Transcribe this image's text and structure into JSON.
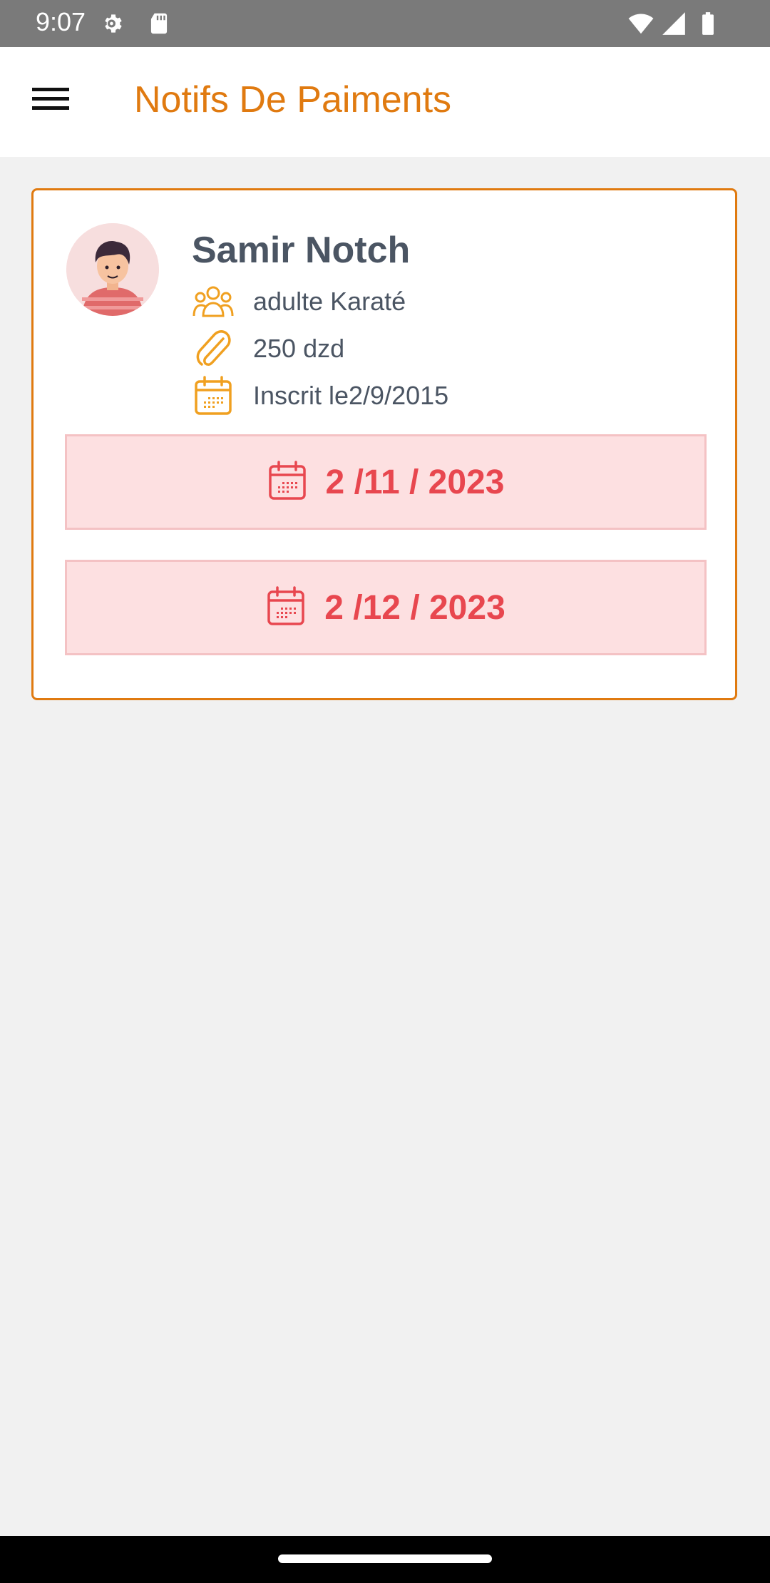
{
  "status_bar": {
    "time": "9:07",
    "icons": [
      "settings-gear-icon",
      "sd-card-icon",
      "wifi-icon",
      "cell-signal-icon",
      "battery-icon"
    ]
  },
  "app_bar": {
    "menu_icon": "hamburger-menu-icon",
    "title": "Notifs De Paiments"
  },
  "student": {
    "avatar_icon": "user-avatar-icon",
    "name": "Samir Notch",
    "details": [
      {
        "icon": "group-icon",
        "text": "adulte Karaté"
      },
      {
        "icon": "paperclip-icon",
        "text": "250 dzd"
      },
      {
        "icon": "calendar-icon",
        "text": "Inscrit le2/9/2015"
      }
    ],
    "payments": [
      {
        "icon": "calendar-icon",
        "date": "2 /11 / 2023"
      },
      {
        "icon": "calendar-icon",
        "date": "2 /12 / 2023"
      }
    ]
  },
  "colors": {
    "accent": "#e07a10",
    "icon_orange": "#f0a020",
    "payment_bg": "#fde0e1",
    "payment_text": "#e8474f",
    "text_gray": "#4b5563",
    "background": "#f1f1f1"
  }
}
